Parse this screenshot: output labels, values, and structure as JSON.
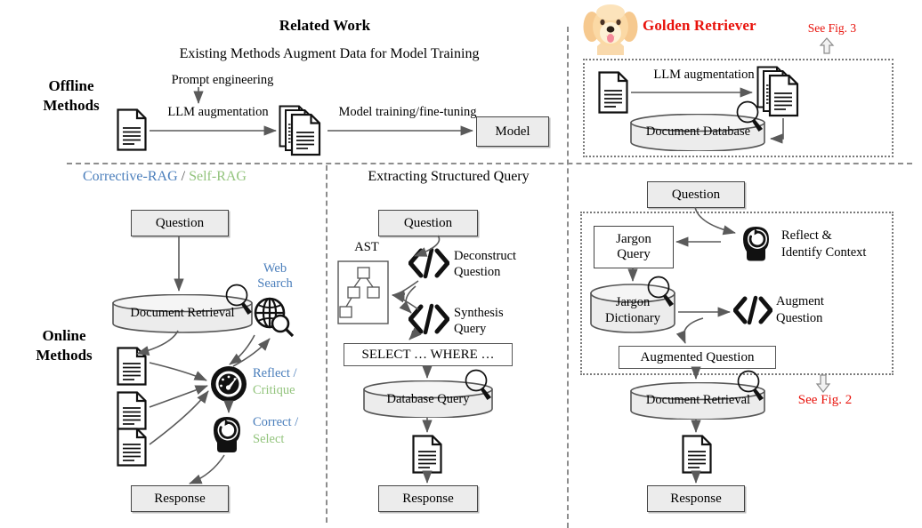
{
  "figure": {
    "left_title": "Related Work",
    "left_subtitle": "Existing Methods Augment Data for Model Training",
    "right_title": "Golden Retriever",
    "dog_icon": "golden-retriever-dog-icon",
    "see_fig_3": "See Fig. 3",
    "see_fig_2": "See Fig. 2",
    "up_arrow_icon": "arrow-up-icon",
    "down_arrow_icon": "arrow-down-icon",
    "row_labels": {
      "offline": "Offline\nMethods",
      "offline_line1": "Offline",
      "offline_line2": "Methods",
      "online_line1": "Online",
      "online_line2": "Methods"
    },
    "colors": {
      "red": "#e8120b",
      "blue": "#4a7ebb",
      "green": "#93c47d",
      "box_fill": "#ececec",
      "stroke": "#444444",
      "divider": "#8d8d8d"
    }
  },
  "offline_related_work": {
    "doc_icon": "document-icon",
    "prompt_engineering": "Prompt engineering",
    "llm_augmentation": "LLM augmentation",
    "docs_stack_icon": "document-stack-icon",
    "model_training": "Model training/fine-tuning",
    "model_box": "Model"
  },
  "offline_golden_retriever": {
    "doc_icon": "document-icon",
    "llm_augmentation": "LLM augmentation",
    "docs_stack_icon": "document-stack-icon",
    "document_database": "Document Database",
    "magnifier_icon": "magnifier-icon"
  },
  "online_rag": {
    "header_part1": "Corrective-RAG",
    "header_sep": " / ",
    "header_part2": "Self-RAG",
    "question": "Question",
    "document_retrieval": "Document Retrieval",
    "web_search_line1": "Web",
    "web_search_line2": "Search",
    "globe_icon": "globe-search-icon",
    "magnifier_icon": "magnifier-icon",
    "doc_icon": "document-icon",
    "gauge_icon": "gauge-meter-icon",
    "head_icon": "head-refresh-icon",
    "reflect_blue": "Reflect /",
    "critique_green": "Critique",
    "correct_blue": "Correct /",
    "select_green": "Select",
    "response": "Response"
  },
  "online_structured_query": {
    "header": "Extracting Structured Query",
    "question": "Question",
    "ast_label": "AST",
    "ast_icon": "ast-tree-icon",
    "code_icon": "code-brackets-icon",
    "deconstruct_line1": "Deconstruct",
    "deconstruct_line2": "Question",
    "synthesis_line1": "Synthesis",
    "synthesis_line2": "Query",
    "sql": "SELECT … WHERE …",
    "database_query": "Database Query",
    "magnifier_icon": "magnifier-icon",
    "doc_icon": "document-icon",
    "response": "Response"
  },
  "online_golden_retriever": {
    "question": "Question",
    "head_icon": "head-refresh-icon",
    "reflect_line1": "Reflect &",
    "reflect_line2": "Identify Context",
    "jargon_query_line1": "Jargon",
    "jargon_query_line2": "Query",
    "jargon_dict_line1": "Jargon",
    "jargon_dict_line2": "Dictionary",
    "magnifier_icon": "magnifier-icon",
    "code_icon": "code-brackets-icon",
    "augment_line1": "Augment",
    "augment_line2": "Question",
    "augmented_question": "Augmented Question",
    "document_retrieval": "Document Retrieval",
    "doc_icon": "document-icon",
    "response": "Response"
  }
}
